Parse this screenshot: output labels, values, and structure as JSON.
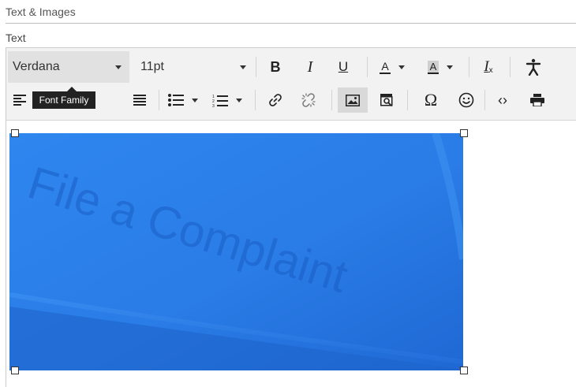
{
  "page": {
    "section_header": "Text & Images",
    "field_label": "Text"
  },
  "toolbar": {
    "font_family": {
      "value": "Verdana",
      "tooltip": "Font Family"
    },
    "font_size": {
      "value": "11pt"
    },
    "bold_label": "B",
    "italic_label": "I",
    "underline_label": "U",
    "text_color_label": "A",
    "bg_color_label": "A",
    "clear_format_label": "I",
    "clear_format_sub": "x",
    "special_char_label": "Ω",
    "code_label": "‹›",
    "icons": [
      "align-left-icon",
      "align-justify-icon",
      "bullet-list-icon",
      "numbered-list-icon",
      "link-icon",
      "unlink-icon",
      "image-icon",
      "media-gallery-icon",
      "emoticon-icon",
      "accessibility-icon",
      "print-icon"
    ]
  },
  "content": {
    "image_text": "File a Complaint",
    "image_color": "#2b7fe8"
  },
  "colors": {
    "toolbar_bg": "#f2f2f2",
    "tooltip_bg": "#222222",
    "active_button_bg": "#d9d9d9"
  }
}
